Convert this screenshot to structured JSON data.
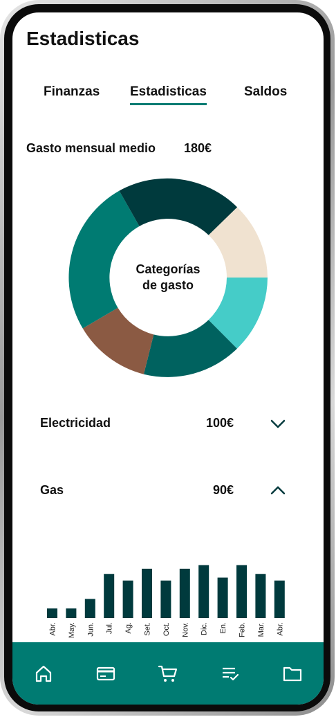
{
  "header": {
    "title": "Estadisticas"
  },
  "tabs": [
    {
      "label": "Finanzas",
      "active": false
    },
    {
      "label": "Estadisticas",
      "active": true
    },
    {
      "label": "Saldos",
      "active": false
    }
  ],
  "summary": {
    "label": "Gasto mensual medio",
    "value": "180€"
  },
  "donut": {
    "center_line1": "Categorías",
    "center_line2": "de gasto",
    "segment_colors": [
      "#f0e2d0",
      "#45ccc8",
      "#00625f",
      "#8b5a43",
      "#007b72",
      "#003a3d"
    ]
  },
  "categories": [
    {
      "label": "Electricidad",
      "amount": "100€",
      "chevron": "chevron-down-icon"
    },
    {
      "label": "Gas",
      "amount": "90€",
      "chevron": "chevron-up-icon"
    }
  ],
  "chart_data": {
    "type": "bar",
    "categories": [
      "Abr.",
      "May.",
      "Jun.",
      "Jul.",
      "Ag.",
      "Set.",
      "Oct.",
      "Nov.",
      "Dic.",
      "En.",
      "Feb.",
      "Mar.",
      "Abr."
    ],
    "values": [
      13,
      13,
      26,
      60,
      51,
      67,
      51,
      67,
      72,
      55,
      72,
      60,
      51
    ],
    "ylim": [
      0,
      80
    ],
    "color": "#003a3d"
  },
  "bottom_nav": [
    {
      "icon": "home-icon"
    },
    {
      "icon": "card-icon"
    },
    {
      "icon": "cart-icon"
    },
    {
      "icon": "checklist-icon"
    },
    {
      "icon": "folder-icon"
    }
  ],
  "colors": {
    "accent": "#007b72",
    "dark": "#003a3d"
  }
}
